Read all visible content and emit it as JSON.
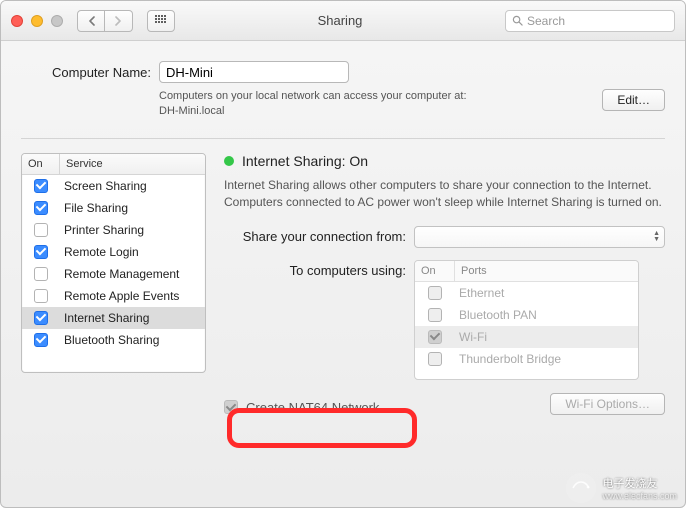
{
  "window": {
    "title": "Sharing"
  },
  "search": {
    "placeholder": "Search"
  },
  "computer": {
    "label": "Computer Name:",
    "value": "DH-Mini",
    "note_line1": "Computers on your local network can access your computer at:",
    "note_line2": "DH-Mini.local",
    "edit_label": "Edit…"
  },
  "services": {
    "header_on": "On",
    "header_service": "Service",
    "items": [
      {
        "label": "Screen Sharing",
        "checked": true
      },
      {
        "label": "File Sharing",
        "checked": true
      },
      {
        "label": "Printer Sharing",
        "checked": false
      },
      {
        "label": "Remote Login",
        "checked": true
      },
      {
        "label": "Remote Management",
        "checked": false
      },
      {
        "label": "Remote Apple Events",
        "checked": false
      },
      {
        "label": "Internet Sharing",
        "checked": true,
        "selected": true
      },
      {
        "label": "Bluetooth Sharing",
        "checked": true
      }
    ]
  },
  "right": {
    "status_text": "Internet Sharing: On",
    "description": "Internet Sharing allows other computers to share your connection to the Internet. Computers connected to AC power won't sleep while Internet Sharing is turned on.",
    "share_from_label": "Share your connection from:",
    "to_computers_label": "To computers using:",
    "ports_header_on": "On",
    "ports_header_ports": "Ports",
    "ports": [
      {
        "label": "Ethernet",
        "checked": false
      },
      {
        "label": "Bluetooth PAN",
        "checked": false
      },
      {
        "label": "Wi-Fi",
        "checked": true,
        "selected": true
      },
      {
        "label": "Thunderbolt Bridge",
        "checked": false
      }
    ],
    "nat64_label": "Create NAT64 Network",
    "nat64_checked": true,
    "wifi_options_label": "Wi-Fi Options…"
  },
  "watermark": {
    "text": "电子发烧友",
    "sub": "www.elecfans.com"
  }
}
